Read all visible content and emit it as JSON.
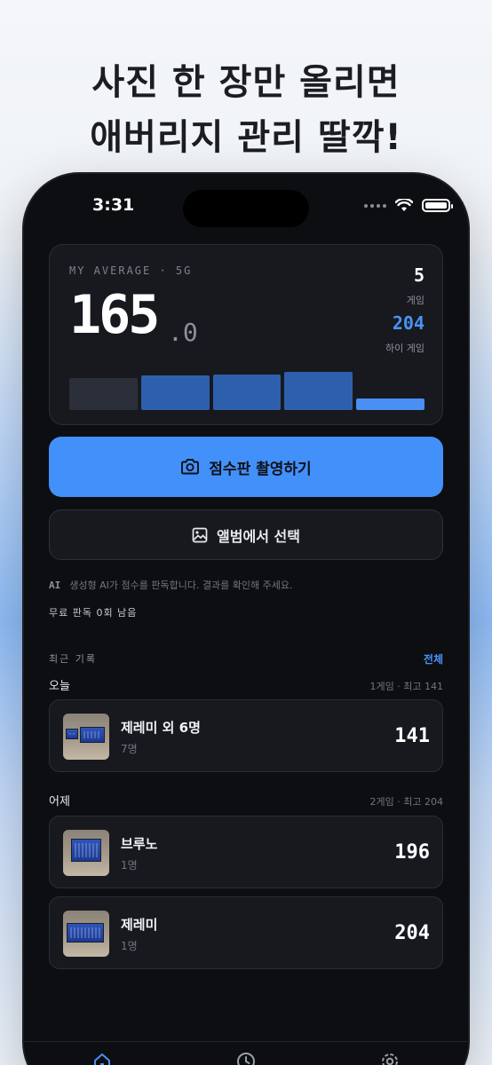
{
  "headline": {
    "line1": "사진 한 장만 올리면",
    "line2": "애버리지 관리 딸깍!"
  },
  "status_bar": {
    "time": "3:31"
  },
  "summary": {
    "label": "MY AVERAGE · 5G",
    "average_int": "165",
    "average_dec": ".0",
    "games_value": "5",
    "games_label": "게임",
    "high_value": "204",
    "high_label": "하이 게임",
    "bar_levels": [
      0.72,
      0.78,
      0.8,
      0.87,
      0.26
    ],
    "bar_colors": [
      "#2a2f39",
      "#2e5fad",
      "#2e5fad",
      "#2e5fad",
      "#4a8ff3"
    ]
  },
  "actions": {
    "scan_label": "점수판 촬영하기",
    "scan_icon": "camera-icon",
    "album_label": "앨범에서 선택",
    "album_icon": "image-icon"
  },
  "ai_note": {
    "tag": "AI",
    "text": "생성형 AI가 점수를 판독합니다. 결과를 확인해 주세요."
  },
  "free_left": "무료 판독 0회 남음",
  "recent": {
    "title": "최근 기록",
    "see_all": "전체",
    "groups": [
      {
        "day": "오늘",
        "summary": "1게임 · 최고 141",
        "items": [
          {
            "name": "제레미 외 6명",
            "count": "7명",
            "score": "141"
          }
        ]
      },
      {
        "day": "어제",
        "summary": "2게임 · 최고 204",
        "items": [
          {
            "name": "브루노",
            "count": "1명",
            "score": "196"
          },
          {
            "name": "제레미",
            "count": "1명",
            "score": "204"
          }
        ]
      }
    ]
  },
  "tabbar": {
    "tabs": [
      "home-icon",
      "clock-icon",
      "gear-icon"
    ],
    "active_color": "#4a8ff3"
  }
}
